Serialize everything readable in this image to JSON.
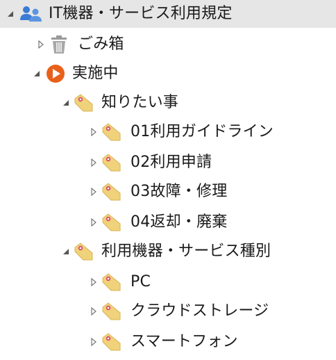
{
  "tree": {
    "root": {
      "label": "IT機器・サービス利用規定",
      "icon": "people-icon",
      "expanded": true
    },
    "trash": {
      "label": "ごみ箱",
      "icon": "trash-icon",
      "expanded": false
    },
    "active": {
      "label": "実施中",
      "icon": "play-circle-icon",
      "expanded": true
    },
    "group1": {
      "label": "知りたい事",
      "icon": "tag-icon",
      "expanded": true,
      "items": [
        {
          "label": "01利用ガイドライン",
          "icon": "tag-icon"
        },
        {
          "label": "02利用申請",
          "icon": "tag-icon"
        },
        {
          "label": "03故障・修理",
          "icon": "tag-icon"
        },
        {
          "label": "04返却・廃棄",
          "icon": "tag-icon"
        }
      ]
    },
    "group2": {
      "label": "利用機器・サービス種別",
      "icon": "tag-icon",
      "expanded": true,
      "items": [
        {
          "label": "PC",
          "icon": "tag-icon"
        },
        {
          "label": "クラウドストレージ",
          "icon": "tag-icon"
        },
        {
          "label": "スマートフォン",
          "icon": "tag-icon"
        }
      ]
    }
  },
  "colors": {
    "selected_bg": "#e6e6e6",
    "people_icon": "#3a7bd5",
    "play_icon": "#e8611a",
    "tag_fill": "#f0d27a",
    "tag_hole": "#d9466b",
    "arrow": "#555555",
    "trash": "#9a9a9a"
  }
}
